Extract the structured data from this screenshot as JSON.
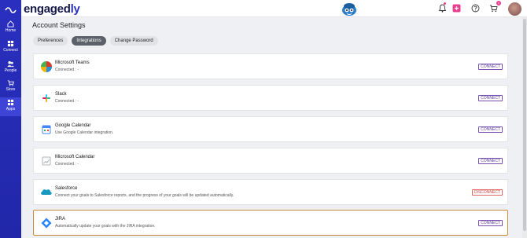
{
  "app": {
    "brand_main": "engaged",
    "brand_accent": "ly"
  },
  "nav": [
    {
      "label": "Home",
      "icon": "home-icon"
    },
    {
      "label": "Connect",
      "icon": "connect-icon"
    },
    {
      "label": "People",
      "icon": "people-icon"
    },
    {
      "label": "Store",
      "icon": "store-icon"
    },
    {
      "label": "Apps",
      "icon": "apps-icon",
      "active": true
    }
  ],
  "topbar": {
    "notification_badge": "1"
  },
  "page": {
    "title": "Account Settings"
  },
  "tabs": [
    {
      "label": "Preferences",
      "active": false
    },
    {
      "label": "Integrations",
      "active": true
    },
    {
      "label": "Change Password",
      "active": false
    }
  ],
  "integrations": [
    {
      "name": "Microsoft Teams",
      "desc": "Connected : -",
      "action": "CONNECT"
    },
    {
      "name": "Slack",
      "desc": "Connected : -",
      "action": "CONNECT"
    },
    {
      "name": "Google Calendar",
      "desc": "Use Google Calendar integration.",
      "action": "CONNECT"
    },
    {
      "name": "Microsoft Calendar",
      "desc": "Connected : -",
      "action": "CONNECT"
    },
    {
      "name": "Salesforce",
      "desc": "Connect your goals to Salesforce reports, and the progress of your goals will be updated automatically.",
      "action": "DISCONNECT"
    },
    {
      "name": "JIRA",
      "desc": "Automatically update your goals with the JIRA integration.",
      "action": "CONNECT"
    }
  ],
  "colors": {
    "nav_bg": "#2a2fbf",
    "accent": "#5b3a96",
    "danger": "#d03c3c",
    "highlight_border": "#c98a39"
  }
}
